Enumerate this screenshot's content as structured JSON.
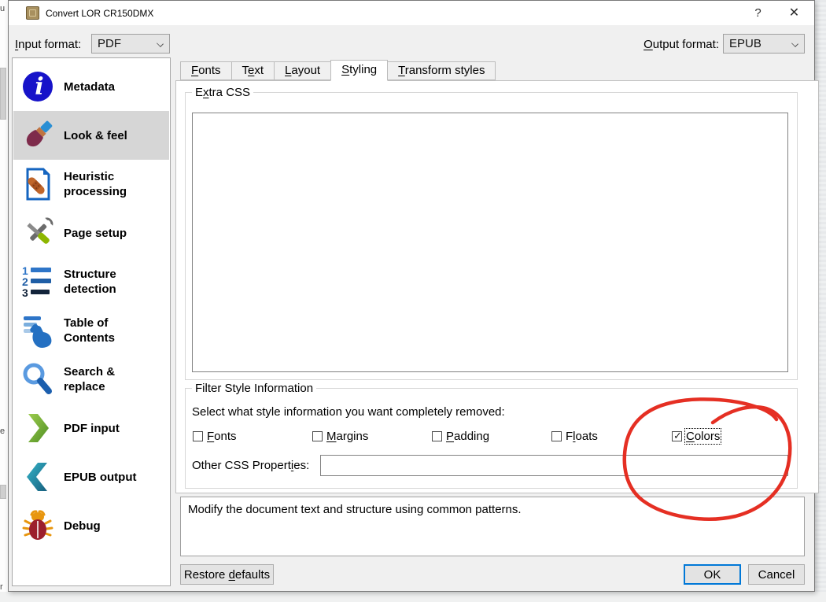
{
  "window": {
    "title": "Convert LOR CR150DMX",
    "help_glyph": "?",
    "close_glyph": "✕"
  },
  "format_bar": {
    "input_label": {
      "pre": "",
      "key": "I",
      "post": "nput format:"
    },
    "input_value": "PDF",
    "output_label": {
      "pre": "",
      "key": "O",
      "post": "utput format:"
    },
    "output_value": "EPUB"
  },
  "sidebar": {
    "items": [
      {
        "label": "Metadata",
        "icon": "info-icon"
      },
      {
        "label": "Look & feel",
        "icon": "paintbrush-icon",
        "selected": true
      },
      {
        "label": "Heuristic\nprocessing",
        "icon": "bandage-document-icon"
      },
      {
        "label": "Page setup",
        "icon": "tools-icon"
      },
      {
        "label": "Structure\ndetection",
        "icon": "numbered-list-icon"
      },
      {
        "label": "Table of\nContents",
        "icon": "toc-hand-icon"
      },
      {
        "label": "Search &\nreplace",
        "icon": "magnifier-icon"
      },
      {
        "label": "PDF input",
        "icon": "chevron-right-icon"
      },
      {
        "label": "EPUB output",
        "icon": "chevron-left-icon"
      },
      {
        "label": "Debug",
        "icon": "bug-icon"
      }
    ]
  },
  "tabs": [
    {
      "pre": "",
      "key": "F",
      "post": "onts"
    },
    {
      "pre": "T",
      "key": "e",
      "post": "xt"
    },
    {
      "pre": "",
      "key": "L",
      "post": "ayout"
    },
    {
      "pre": "",
      "key": "S",
      "post": "tyling",
      "active": true
    },
    {
      "pre": "",
      "key": "T",
      "post": "ransform styles"
    }
  ],
  "styling_tab": {
    "extra_css": {
      "label": {
        "pre": "E",
        "key": "x",
        "post": "tra CSS"
      },
      "value": ""
    },
    "filter": {
      "label": "Filter Style Information",
      "description": "Select what style information you want completely removed:",
      "checkboxes": [
        {
          "pre": "",
          "key": "F",
          "post": "onts",
          "checked": false
        },
        {
          "pre": "",
          "key": "M",
          "post": "argins",
          "checked": false
        },
        {
          "pre": "",
          "key": "P",
          "post": "adding",
          "checked": false
        },
        {
          "pre": "F",
          "key": "l",
          "post": "oats",
          "checked": false
        },
        {
          "pre": "",
          "key": "C",
          "post": "olors",
          "checked": true,
          "focused": true
        }
      ],
      "other_css_label": {
        "pre": "Other CSS Propert",
        "key": "i",
        "post": "es:"
      },
      "other_css_value": "",
      "other_css_placeholder": ""
    }
  },
  "description_box": "Modify the document text and structure using common patterns.",
  "footer": {
    "restore_label": {
      "pre": "Restore ",
      "key": "d",
      "post": "efaults"
    },
    "ok_label": "OK",
    "cancel_label": "Cancel"
  },
  "icons": {
    "check_glyph": "✓"
  },
  "annotation": {
    "shape": "hand-drawn-ellipse",
    "target": "Colors checkbox",
    "color": "#e42417"
  },
  "left_edge_fragments": {
    "f1": "u",
    "f2": "e",
    "f3": "r"
  },
  "colors": {
    "accent_blue": "#0078d7",
    "dialog_bg": "#f0f0f0",
    "selection_gray": "#d6d6d6"
  }
}
